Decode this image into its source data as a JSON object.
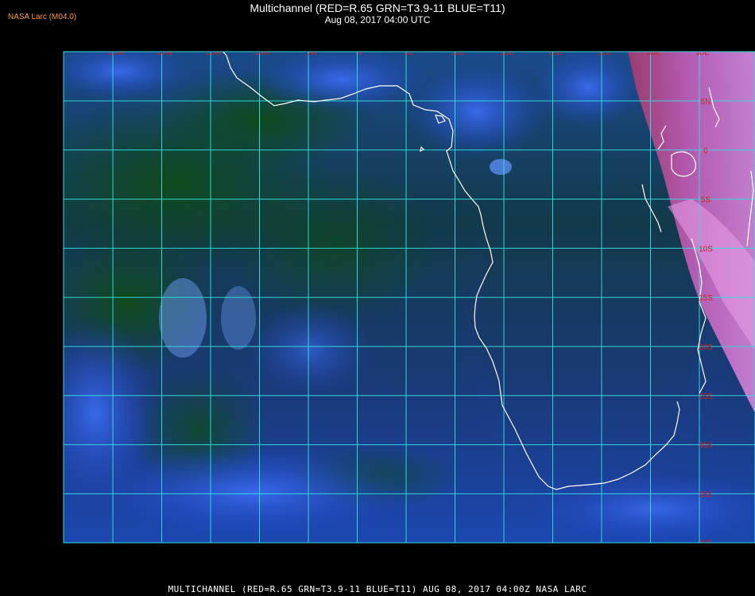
{
  "header": {
    "title": "Multichannel (RED=R.65 GRN=T3.9-11 BLUE=T11)",
    "subtitle": "Aug 08, 2017 04:00 UTC",
    "credit": "NASA Larc (M04.0)"
  },
  "footer": {
    "caption": "MULTICHANNEL (RED=R.65 GRN=T3.9-11 BLUE=T11) AUG 08, 2017 04:00Z  NASA LARC"
  },
  "map": {
    "longitude_labels": [
      "25W",
      "20W",
      "15W",
      "10W",
      "5W",
      "0",
      "5E",
      "10E",
      "15E",
      "20E",
      "25E",
      "30E",
      "35E"
    ],
    "latitude_labels": [
      "5N",
      "0",
      "5S",
      "10S",
      "15S",
      "20S",
      "25S",
      "30S",
      "35S",
      "40S"
    ],
    "colors": {
      "grid": "#33dddd",
      "coastline": "#ffffff",
      "labels": "#cc2222",
      "ocean_green": "#0c3a14",
      "cloud_blue": "#2a4fd8",
      "land_magenta": "#d060c0"
    }
  }
}
